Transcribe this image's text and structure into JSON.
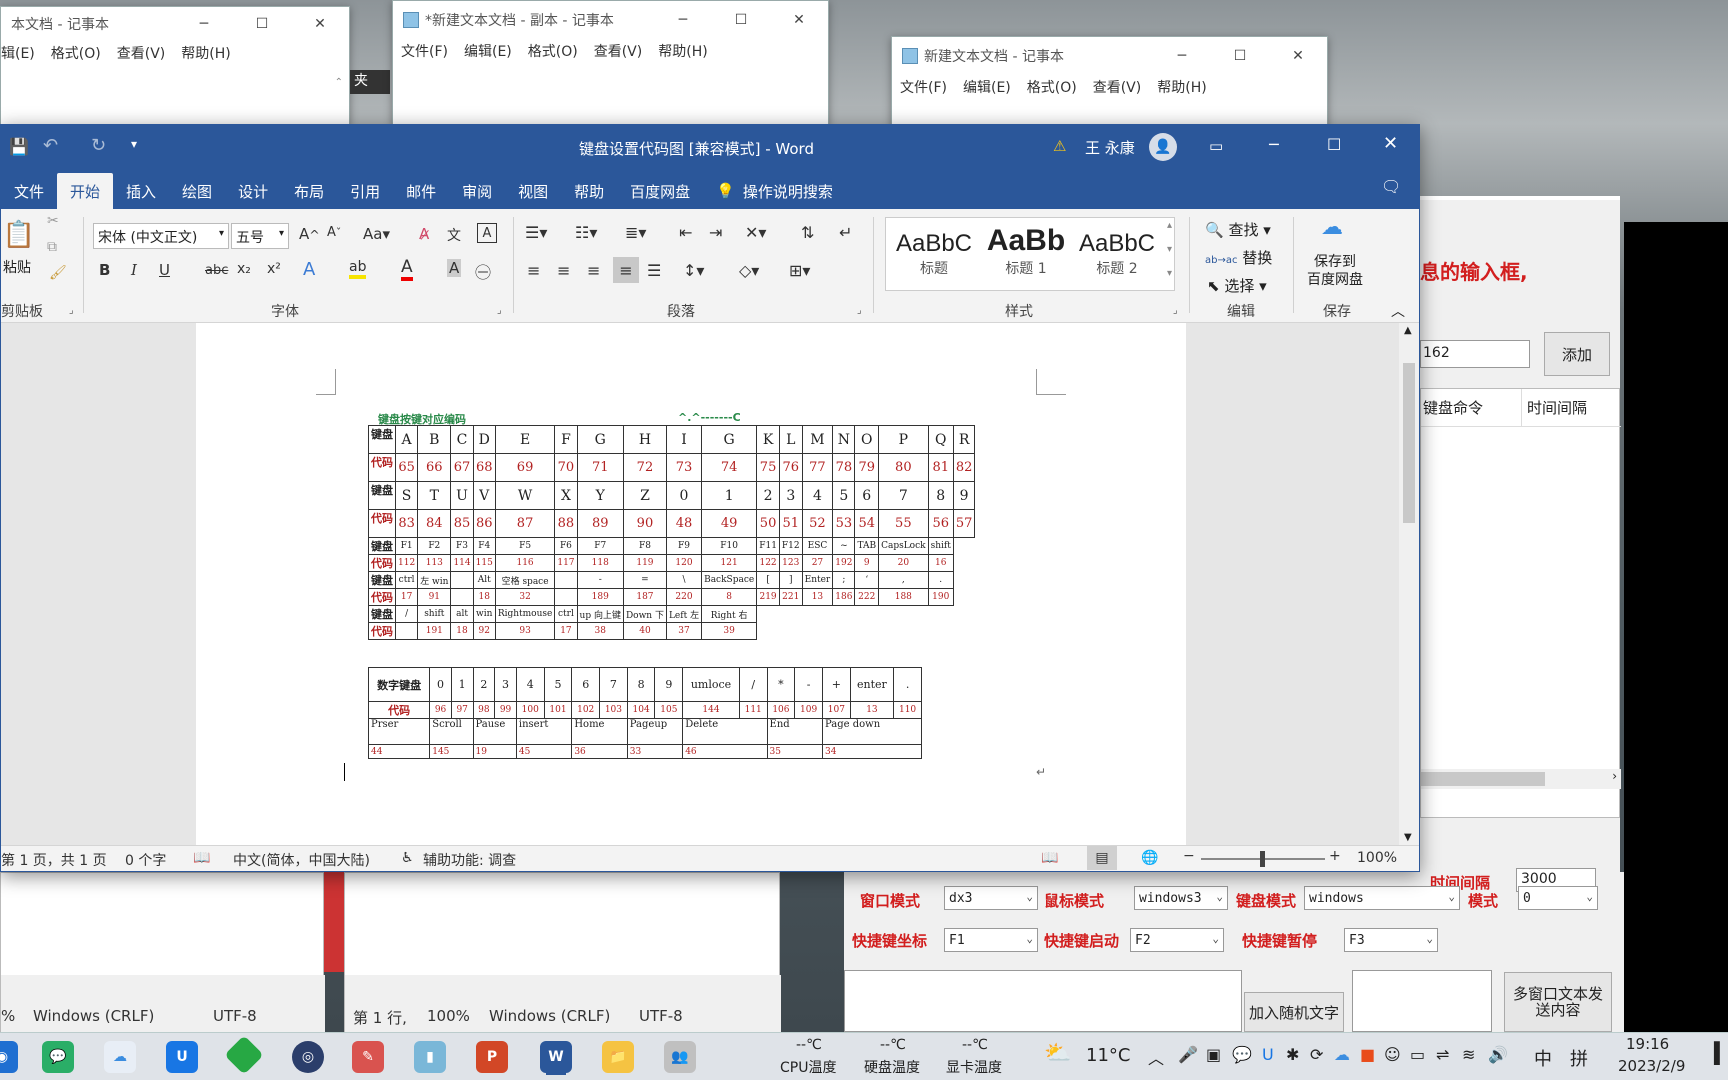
{
  "notepad1": {
    "title": "本文档 - 记事本",
    "menu": [
      "辑(E)",
      "格式(O)",
      "查看(V)",
      "帮助(H)"
    ],
    "status_encoding_prefix": "%",
    "line_ending": "Windows (CRLF)",
    "encoding": "UTF-8"
  },
  "notepad2": {
    "title": "*新建文本文档 - 副本 - 记事本",
    "menu": [
      "文件(F)",
      "编辑(E)",
      "格式(O)",
      "查看(V)",
      "帮助(H)"
    ],
    "status_pos": "第 1 行,",
    "zoom": "100%",
    "line_ending": "Windows (CRLF)",
    "encoding": "UTF-8"
  },
  "notepad3": {
    "title": "新建文本文档 - 记事本",
    "menu": [
      "文件(F)",
      "编辑(E)",
      "格式(O)",
      "查看(V)",
      "帮助(H)"
    ]
  },
  "desktop_fragment": {
    "text": "夹"
  },
  "word": {
    "title": "键盘设置代码图 [兼容模式] - Word",
    "user": "王 永康",
    "tabs": [
      "文件",
      "开始",
      "插入",
      "绘图",
      "设计",
      "布局",
      "引用",
      "邮件",
      "审阅",
      "视图",
      "帮助",
      "百度网盘"
    ],
    "search": "操作说明搜索",
    "font_name": "宋体 (中文正文)",
    "font_size": "五号",
    "groups": {
      "clipboard": "剪贴板",
      "font": "字体",
      "paragraph": "段落",
      "styles": "样式",
      "edit": "编辑",
      "save": "保存"
    },
    "paste": "粘贴",
    "styles": [
      {
        "sample": "AaBbC",
        "name": "标题"
      },
      {
        "sample": "AaBb",
        "name": "标题 1"
      },
      {
        "sample": "AaBbC",
        "name": "标题 2"
      }
    ],
    "edit_items": [
      "查找",
      "替换",
      "选择"
    ],
    "save_label": "保存到\n百度网盘",
    "status": {
      "page": "第 1 页，共 1 页",
      "words": "0 个字",
      "lang": "中文(简体，中国大陆)",
      "access": "辅助功能: 调查",
      "zoom": "100%"
    }
  },
  "doc": {
    "heading_left": "键盘按键对应编码",
    "heading_right": "^.^-------C",
    "row1_keys": [
      "A",
      "B",
      "C",
      "D",
      "E",
      "F",
      "G",
      "H",
      "I",
      "G",
      "K",
      "L",
      "M",
      "N",
      "O",
      "P",
      "Q",
      "R"
    ],
    "row1_codes": [
      "65",
      "66",
      "67",
      "68",
      "69",
      "70",
      "71",
      "72",
      "73",
      "74",
      "75",
      "76",
      "77",
      "78",
      "79",
      "80",
      "81",
      "82"
    ],
    "row2_keys": [
      "S",
      "T",
      "U",
      "V",
      "W",
      "X",
      "Y",
      "Z",
      "0",
      "1",
      "2",
      "3",
      "4",
      "5",
      "6",
      "7",
      "8",
      "9"
    ],
    "row2_codes": [
      "83",
      "84",
      "85",
      "86",
      "87",
      "88",
      "89",
      "90",
      "48",
      "49",
      "50",
      "51",
      "52",
      "53",
      "54",
      "55",
      "56",
      "57"
    ],
    "label_key": "键盘",
    "label_code": "代码",
    "row3_keys": [
      "F1",
      "F2",
      "F3",
      "F4",
      "F5",
      "F6",
      "F7",
      "F8",
      "F9",
      "F10",
      "F11",
      "F12",
      "ESC",
      "~",
      "TAB",
      "CapsLock",
      "shift"
    ],
    "row3_codes": [
      "112",
      "113",
      "114",
      "115",
      "116",
      "117",
      "118",
      "119",
      "120",
      "121",
      "122",
      "123",
      "27",
      "192",
      "9",
      "20",
      "16"
    ],
    "row4_keys": [
      "ctrl",
      "左 win",
      "",
      "Alt",
      "空格 space",
      "",
      "-",
      "=",
      "\\",
      "BackSpace",
      "[",
      "]",
      "Enter",
      ";",
      "‘",
      ",",
      "."
    ],
    "row4_codes": [
      "17",
      "91",
      "",
      "18",
      "32",
      "",
      "189",
      "187",
      "220",
      "8",
      "219",
      "221",
      "13",
      "186",
      "222",
      "188",
      "190"
    ],
    "row5_keys": [
      "/",
      "shift",
      "alt",
      "win",
      "Rightmouse",
      "ctrl",
      "up 向上键",
      "Down 下",
      "Left 左",
      "Right 右"
    ],
    "row5_codes": [
      "",
      "191",
      "18",
      "92",
      "93",
      "17",
      "38",
      "40",
      "37",
      "39"
    ],
    "num_label": "数字键盘",
    "num_keys": [
      "0",
      "1",
      "2",
      "3",
      "4",
      "5",
      "6",
      "7",
      "8",
      "9",
      "umloce",
      "/",
      "*",
      "-",
      "+",
      "enter",
      "."
    ],
    "num_codes": [
      "96",
      "97",
      "98",
      "99",
      "100",
      "101",
      "102",
      "103",
      "104",
      "105",
      "144",
      "111",
      "106",
      "109",
      "107",
      "13",
      "110"
    ],
    "misc_keys": [
      "Prser",
      "Scroll",
      "Pause",
      "insert",
      "Home",
      "Pageup",
      "Delete",
      "End",
      "Page down"
    ],
    "misc_codes": [
      "44",
      "145",
      "19",
      "45",
      "36",
      "33",
      "46",
      "35",
      "34"
    ],
    "return_mark": "↵"
  },
  "rightapp": {
    "banner": "息的输入框,",
    "input_value": "162",
    "add_button": "添加",
    "col1": "键盘命令",
    "col2": "时间间隔",
    "interval_label": "时间间隔",
    "interval_value": "3000",
    "window_mode_label": "窗口模式",
    "window_mode": "dx3",
    "mouse_mode_label": "鼠标模式",
    "mouse_mode": "windows3",
    "kb_mode_label": "键盘模式",
    "kb_mode": "windows",
    "mode_label": "模式",
    "mode": "0",
    "hotkey_coord_label": "快捷键坐标",
    "hotkey_coord": "F1",
    "hotkey_start_label": "快捷键启动",
    "hotkey_start": "F2",
    "hotkey_pause_label": "快捷键暂停",
    "hotkey_pause": "F3",
    "random_text_button": "加入随机文字",
    "multi_window_button": "多窗口文本发送内容"
  },
  "taskbar": {
    "cpu_temp": "--℃",
    "cpu_label": "CPU温度",
    "disk_temp": "--℃",
    "disk_label": "硬盘温度",
    "gpu_temp": "--℃",
    "gpu_label": "显卡温度",
    "weather": "11°C",
    "ime": "中",
    "ime2": "拼",
    "time": "19:16",
    "date": "2023/2/9"
  }
}
